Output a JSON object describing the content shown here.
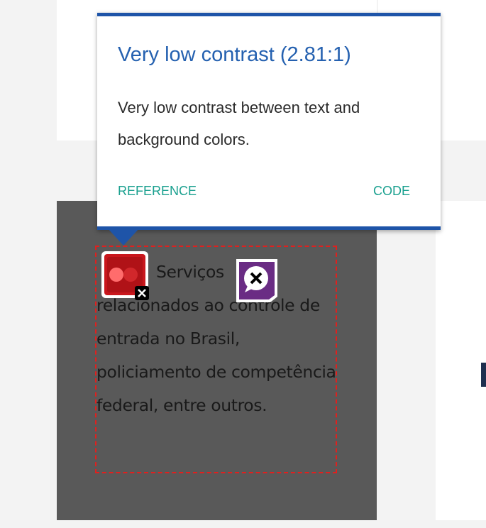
{
  "tooltip": {
    "title": "Very low contrast (2.81:1)",
    "description": "Very low contrast between text and background colors.",
    "reference_label": "REFERENCE",
    "code_label": "CODE",
    "accent_color": "#1e54a8",
    "link_color": "#1aa08f"
  },
  "content": {
    "paragraph": "Serviços relacionados ao controle de entrada no Brasil, policiamento de competência federal, entre outros.",
    "card_background": "#595959",
    "outline_color": "#e0201e"
  },
  "icons": {
    "contrast_badge": "contrast-error-icon",
    "alt_badge": "alt-text-error-icon"
  }
}
